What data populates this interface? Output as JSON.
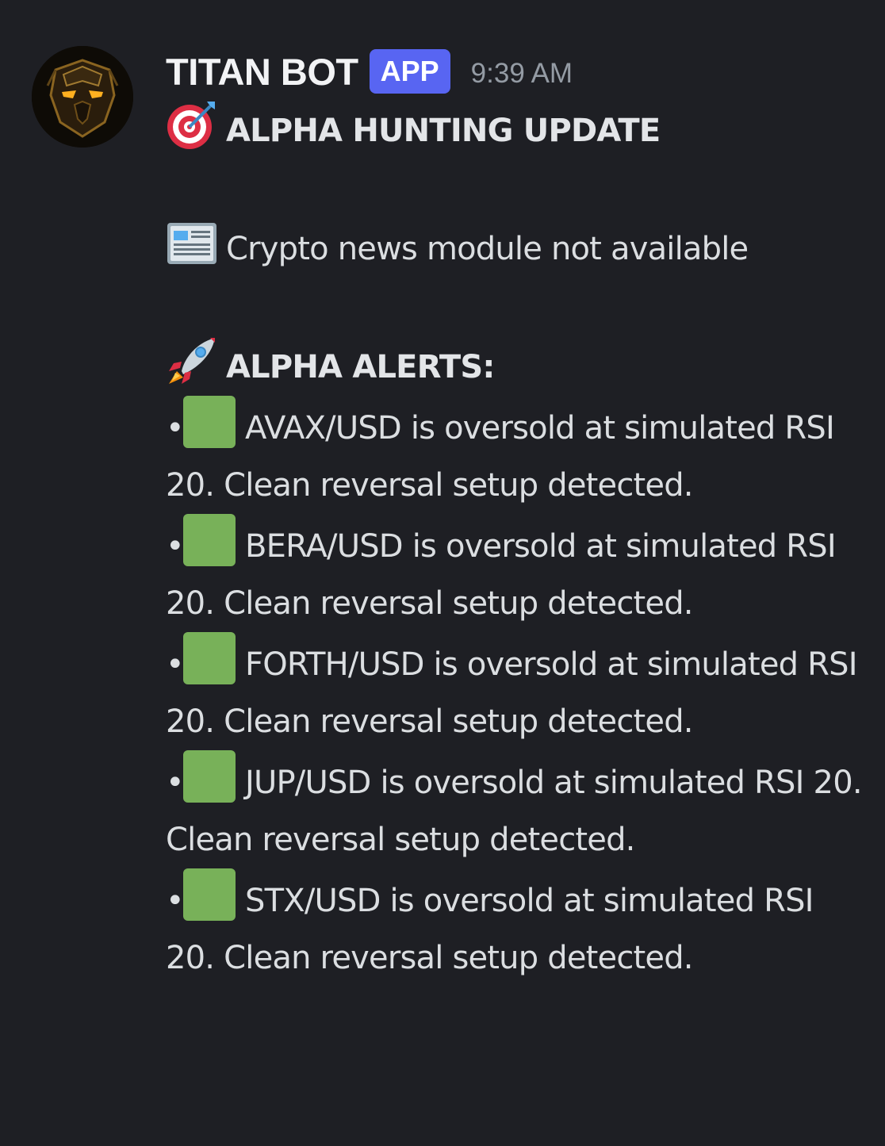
{
  "message": {
    "username": "TITAN BOT",
    "badge": "APP",
    "timestamp": "9:39 AM",
    "title_icon": "direct-hit-target-icon",
    "title": "ALPHA HUNTING UPDATE",
    "news_icon": "newspaper-icon",
    "news_text": "Crypto news module not available",
    "alerts_icon": "rocket-icon",
    "alerts_heading": "ALPHA ALERTS:",
    "bullet": "•",
    "alert_marker_icon": "green-square-icon",
    "alert_marker_color": "#78b159",
    "alerts": [
      "AVAX/USD is oversold at simulated RSI 20. Clean reversal setup detected.",
      "BERA/USD is oversold at simulated RSI 20. Clean reversal setup detected.",
      "FORTH/USD is oversold at simulated RSI 20. Clean reversal setup detected.",
      "JUP/USD is oversold at simulated RSI 20. Clean reversal setup detected.",
      "STX/USD is oversold at simulated RSI 20. Clean reversal setup detected."
    ]
  },
  "colors": {
    "background": "#1e1f24",
    "username": "#f2f3f5",
    "badge": "#5865f2",
    "timestamp": "#949ba4",
    "text": "#dbdee1"
  }
}
